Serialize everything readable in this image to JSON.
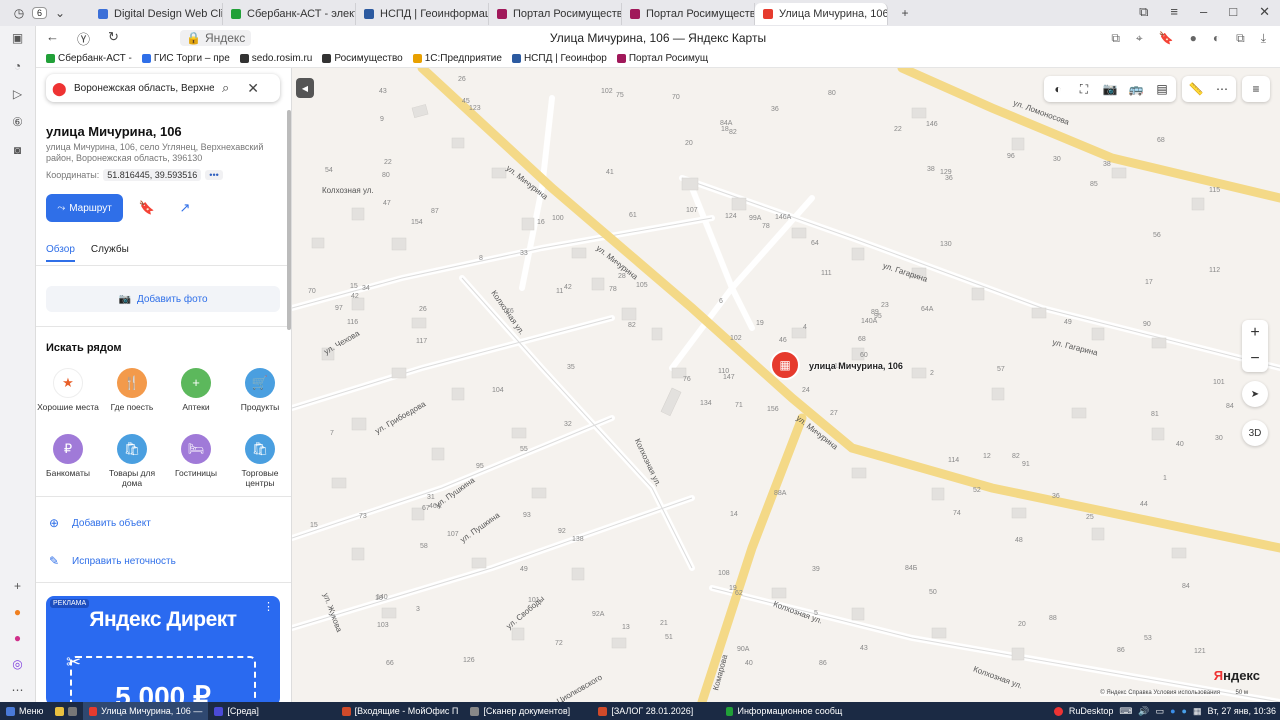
{
  "browser": {
    "tab_count": "6",
    "tabs": [
      {
        "label": "Digital Design Web Client",
        "color": "#3b6fd8"
      },
      {
        "label": "Сбербанк-АСТ - электрон",
        "color": "#21a038"
      },
      {
        "label": "НСПД | Геоинформацион",
        "color": "#2c5aa0"
      },
      {
        "label": "Портал Росимущества",
        "color": "#a0185a"
      },
      {
        "label": "Портал Росимущества",
        "color": "#a0185a"
      },
      {
        "label": "Улица Мичурина, 106",
        "color": "#e63b2e"
      }
    ],
    "domain": "Яндекс",
    "page_title": "Улица Мичурина, 106 — Яндекс Карты",
    "bookmarks": [
      {
        "label": "Сбербанк-АСТ -",
        "color": "#21a038"
      },
      {
        "label": "ГИС Торги – пре",
        "color": "#2f6fe8"
      },
      {
        "label": "sedo.rosim.ru",
        "color": "#333333"
      },
      {
        "label": "Росимущество",
        "color": "#333333"
      },
      {
        "label": "1С:Предприятие",
        "color": "#e8a000"
      },
      {
        "label": "НСПД | Геоинфор",
        "color": "#2c5aa0"
      },
      {
        "label": "Портал Росимущ",
        "color": "#a0185a"
      }
    ]
  },
  "panel": {
    "search_value": "Воронежская область, Верхнех",
    "title": "улица Мичурина, 106",
    "address": "улица Мичурина, 106, село Углянец, Верхнехавский район, Воронежская область, 396130",
    "coords_label": "Координаты:",
    "coords_value": "51.816445, 39.593516",
    "coords_more": "•••",
    "route_label": "Маршрут",
    "tabs": [
      "Обзор",
      "Службы"
    ],
    "add_photo": "Добавить фото",
    "nearby_title": "Искать рядом",
    "categories": [
      {
        "label": "Хорошие места",
        "color": "#ffffff",
        "icon": "★"
      },
      {
        "label": "Где поесть",
        "color": "#f39a4b",
        "icon": "🍴"
      },
      {
        "label": "Аптеки",
        "color": "#5cb85c",
        "icon": "+"
      },
      {
        "label": "Продукты",
        "color": "#4a9fe0",
        "icon": "🛒"
      },
      {
        "label": "Банкоматы",
        "color": "#a07ad8",
        "icon": "₽"
      },
      {
        "label": "Товары для дома",
        "color": "#4a9fe0",
        "icon": "🛍"
      },
      {
        "label": "Гостиницы",
        "color": "#a07ad8",
        "icon": "🛏"
      },
      {
        "label": "Торговые центры",
        "color": "#4a9fe0",
        "icon": "🛍"
      }
    ],
    "add_object": "Добавить объект",
    "fix_error": "Исправить неточность",
    "ad": {
      "tag": "РЕКЛАМА",
      "brand": "Яндекс Директ",
      "amount": "5 000 ₽"
    }
  },
  "map": {
    "marker_label": "улица Мичурина, 106",
    "streets": [
      "ул. Мичурина",
      "ул. Мичурина",
      "ул. Мичурина",
      "ул. Гагарина",
      "ул. Гагарина",
      "ул. Ломоносова",
      "Колхозная ул.",
      "Колхозная ул.",
      "Колхозная ул.",
      "Колхозная ул.",
      "ул. Чехова",
      "ул. Грибоедова",
      "ул. Пушкина",
      "ул. Пушкина",
      "ул. Свободы",
      "ул. Жукова",
      "ул. Циолковского",
      "Комарова",
      "Колхозная ул."
    ],
    "house_numbers": [
      "156",
      "154",
      "147",
      "140",
      "140А",
      "138",
      "146",
      "146А",
      "129",
      "125",
      "123",
      "121",
      "117",
      "115",
      "134",
      "130",
      "126",
      "124",
      "111",
      "107",
      "105",
      "103",
      "101",
      "99А",
      "95",
      "91",
      "87",
      "82",
      "116",
      "114",
      "112",
      "110",
      "108",
      "102",
      "100",
      "96",
      "92",
      "86",
      "84",
      "82",
      "80",
      "78",
      "76",
      "74",
      "72",
      "70",
      "68",
      "66",
      "62",
      "60",
      "58",
      "56",
      "54",
      "52",
      "50",
      "49",
      "45",
      "43",
      "39",
      "38",
      "36",
      "35",
      "34",
      "33",
      "30",
      "26",
      "22",
      "20",
      "19",
      "15",
      "14",
      "13",
      "12",
      "11",
      "10",
      "9",
      "8",
      "7",
      "6",
      "5",
      "4",
      "3",
      "2",
      "1",
      "90А",
      "90",
      "88А",
      "88",
      "86",
      "84Б",
      "84А",
      "84",
      "64А",
      "48",
      "46",
      "44",
      "42",
      "40",
      "38",
      "36",
      "104",
      "102",
      "101",
      "97",
      "95",
      "93",
      "92А",
      "89",
      "85",
      "82",
      "81",
      "80",
      "78",
      "76",
      "75",
      "73",
      "71",
      "68",
      "107",
      "70",
      "67",
      "65",
      "64",
      "61",
      "57",
      "55",
      "53",
      "51",
      "49",
      "47",
      "46А",
      "43",
      "42",
      "41",
      "40",
      "36",
      "32",
      "31",
      "30",
      "28",
      "27",
      "26",
      "25",
      "24",
      "23",
      "22",
      "21",
      "20",
      "19",
      "18",
      "17",
      "16",
      "15"
    ],
    "zoom_in": "+",
    "zoom_out": "−",
    "btn_3d": "3D",
    "yandex_logo": "Яндекс",
    "copyright": "© Яндекс  Справка  Условия использования",
    "scale": "50 м"
  },
  "taskbar": {
    "menu": "Меню",
    "items": [
      {
        "label": "Улица Мичурина, 106 —",
        "color": "#e63b2e"
      },
      {
        "label": "[Среда]",
        "color": "#4b4bd8"
      },
      {
        "label": "[Входящие - МойОфис П",
        "color": "#d04a2a"
      },
      {
        "label": "[Сканер документов]",
        "color": "#888888"
      },
      {
        "label": "[ЗАЛОГ 28.01.2026]",
        "color": "#d04a2a"
      },
      {
        "label": "Информационное сообщ",
        "color": "#21a038"
      }
    ],
    "rudesktop": "RuDesktop",
    "clock": "Вт, 27 янв, 10:36"
  }
}
